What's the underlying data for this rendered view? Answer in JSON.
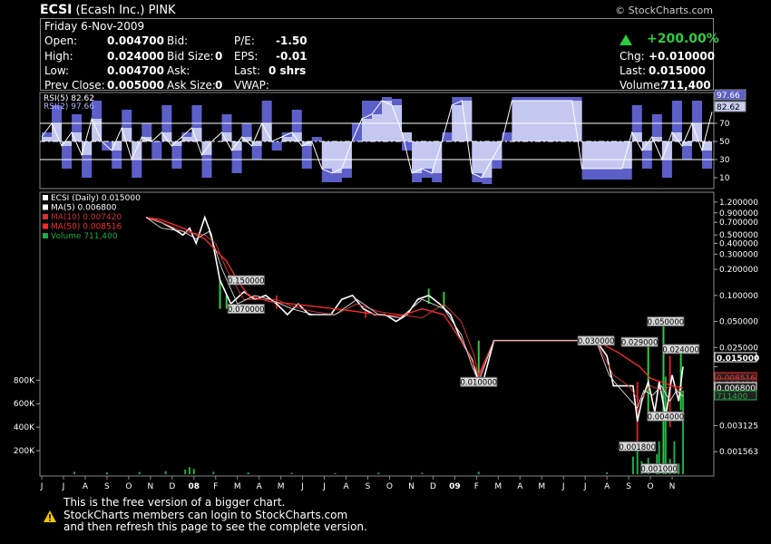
{
  "header": {
    "symbol": "ECSI",
    "company": "(Ecash Inc.)",
    "exchange": "PINK",
    "brand": "© StockCharts.com",
    "date": "Friday  6-Nov-2009"
  },
  "quote": {
    "open_label": "Open:",
    "open": "0.004700",
    "high_label": "High:",
    "high": "0.024000",
    "low_label": "Low:",
    "low": "0.004700",
    "prevclose_label": "Prev Close:",
    "prevclose": "0.005000",
    "bid_label": "Bid:",
    "bid": "",
    "bidsize_label": "Bid Size:",
    "bidsize": "0",
    "ask_label": "Ask:",
    "ask": "",
    "asksize_label": "Ask Size:",
    "asksize": "0",
    "pe_label": "P/E:",
    "pe": "-1.50",
    "eps_label": "EPS:",
    "eps": "-0.01",
    "last_label": "Last:",
    "last": "0 shrs",
    "vwap_label": "VWAP:",
    "vwap": "",
    "pct_change": "+200.00%",
    "chg_label": "Chg:",
    "chg": "+0.010000",
    "last2_label": "Last:",
    "last2": "0.015000",
    "volume_label": "Volume:",
    "volume": "711,400"
  },
  "colors": {
    "background": "#000000",
    "rsi_fill": "#c9cdf2",
    "rsi2_fill": "#5c5fc8",
    "price_line": "#ffffff",
    "ma5": "#ffffff",
    "ma10": "#cc3333",
    "ma50": "#ff2a2a",
    "volume": "#22aa44",
    "up_accent": "#2ecc40"
  },
  "footer": {
    "line1": "This is the free version of a bigger chart.",
    "line2": "StockCharts members can login to StockCharts.com",
    "line3": "and then refresh this page to see the complete version.",
    "warning_icon": "warning-triangle-icon"
  },
  "chart_data": [
    {
      "type": "line",
      "panel": "rsi",
      "legend": [
        "RSI(5) 82.62",
        "RSI(2) 97.66"
      ],
      "ylim": [
        0,
        100
      ],
      "y_ticks": [
        10,
        30,
        50,
        70,
        90
      ],
      "reference_lines": [
        30,
        50,
        70
      ],
      "last_values": [
        "97.66",
        "82.62"
      ],
      "series": [
        {
          "name": "RSI(5)",
          "values": [
            55,
            70,
            45,
            60,
            35,
            75,
            50,
            40,
            65,
            30,
            55,
            50,
            60,
            45,
            55,
            65,
            35,
            50,
            60,
            40,
            55,
            45,
            70,
            50,
            55,
            60,
            45,
            50,
            20,
            15,
            20,
            50,
            75,
            80,
            95,
            90,
            60,
            15,
            20,
            15,
            50,
            90,
            95,
            15,
            10,
            30,
            50,
            95,
            95,
            95,
            95,
            95,
            95,
            95,
            20,
            20,
            20,
            20,
            20,
            60,
            40,
            55,
            30,
            60,
            45,
            70,
            40,
            82.62
          ]
        },
        {
          "name": "RSI(2)",
          "values": [
            60,
            90,
            20,
            80,
            10,
            95,
            40,
            20,
            85,
            10,
            70,
            30,
            90,
            20,
            60,
            90,
            10,
            50,
            80,
            15,
            70,
            30,
            95,
            40,
            60,
            85,
            20,
            55,
            5,
            5,
            10,
            70,
            95,
            95,
            99,
            97,
            40,
            5,
            10,
            5,
            60,
            99,
            99,
            5,
            3,
            20,
            60,
            99,
            99,
            99,
            99,
            99,
            99,
            99,
            8,
            8,
            8,
            8,
            8,
            90,
            20,
            80,
            10,
            95,
            30,
            95,
            20,
            97.66
          ]
        }
      ]
    },
    {
      "type": "line",
      "panel": "price",
      "scale": "log",
      "legend": [
        "ECSI (Daily) 0.015000",
        "MA(5) 0.006800",
        "MA(10) 0.007420",
        "MA(50) 0.008516",
        "Volume 711,400"
      ],
      "x_labels": [
        "J",
        "J",
        "A",
        "S",
        "O",
        "N",
        "D",
        "08",
        "F",
        "M",
        "A",
        "M",
        "J",
        "J",
        "A",
        "S",
        "O",
        "N",
        "D",
        "09",
        "F",
        "M",
        "A",
        "M",
        "J",
        "J",
        "A",
        "S",
        "O",
        "N"
      ],
      "y_ticks": [
        "1.200000",
        "0.900000",
        "0.700000",
        "0.500000",
        "0.400000",
        "0.300000",
        "0.200000",
        "0.100000",
        "0.050000",
        "0.025000",
        "0.015000",
        "0.006800",
        "0.003125",
        "0.001563"
      ],
      "y_tick_values": [
        1.2,
        0.9,
        0.7,
        0.5,
        0.4,
        0.3,
        0.2,
        0.1,
        0.05,
        0.025,
        0.015,
        0.0068,
        0.003125,
        0.001563
      ],
      "last_value_tags": [
        {
          "label": "0.015000",
          "value": 0.015,
          "color": "#ffffff"
        },
        {
          "label": "0.008516",
          "value": 0.008516,
          "color": "#ff2a2a"
        },
        {
          "label": "0.007420",
          "value": 0.00742,
          "color": "#cc3333"
        },
        {
          "label": "0.006800",
          "value": 0.0068,
          "color": "#ffffff"
        },
        {
          "label": "711400",
          "value": 0.0058,
          "color": "#22aa44"
        }
      ],
      "annotations": [
        {
          "label": "0.150000",
          "t": 8.9,
          "value": 0.15
        },
        {
          "label": "0.070000",
          "t": 8.9,
          "value": 0.07
        },
        {
          "label": "0.010000",
          "t": 19.6,
          "value": 0.01
        },
        {
          "label": "0.030000",
          "t": 25.0,
          "value": 0.03
        },
        {
          "label": "0.029000",
          "t": 27.0,
          "value": 0.029
        },
        {
          "label": "0.050000",
          "t": 28.2,
          "value": 0.05
        },
        {
          "label": "0.024000",
          "t": 28.9,
          "value": 0.024
        },
        {
          "label": "0.004000",
          "t": 28.2,
          "value": 0.004
        },
        {
          "label": "0.001800",
          "t": 26.9,
          "value": 0.0018
        },
        {
          "label": "0.001000",
          "t": 27.9,
          "value": 0.001
        }
      ],
      "series": [
        {
          "name": "ECSI (Daily)",
          "t": [
            4.3,
            5.0,
            5.5,
            6.0,
            6.3,
            6.6,
            7.0,
            7.3,
            7.7,
            8.2,
            8.8,
            9.3,
            9.8,
            10.3,
            10.8,
            11.3,
            11.8,
            12.3,
            12.8,
            13.3,
            13.8,
            14.3,
            14.8,
            15.3,
            15.8,
            16.3,
            16.8,
            17.3,
            17.8,
            18.3,
            18.8,
            19.3,
            19.6,
            19.8,
            20.3,
            21.0,
            22.0,
            23.0,
            24.0,
            25.0,
            25.5,
            25.8,
            26.3,
            26.7,
            26.9,
            27.1,
            27.4,
            27.7,
            27.9,
            28.2,
            28.5,
            28.8,
            29.0
          ],
          "values": [
            0.8,
            0.7,
            0.6,
            0.5,
            0.6,
            0.4,
            0.8,
            0.5,
            0.15,
            0.08,
            0.11,
            0.09,
            0.1,
            0.08,
            0.06,
            0.08,
            0.06,
            0.06,
            0.06,
            0.09,
            0.1,
            0.07,
            0.06,
            0.06,
            0.05,
            0.06,
            0.09,
            0.1,
            0.08,
            0.06,
            0.03,
            0.018,
            0.01,
            0.01,
            0.03,
            0.03,
            0.03,
            0.03,
            0.03,
            0.03,
            0.02,
            0.009,
            0.009,
            0.009,
            0.0035,
            0.006,
            0.01,
            0.0045,
            0.01,
            0.004,
            0.012,
            0.006,
            0.015
          ]
        },
        {
          "name": "MA(50)",
          "t": [
            4.3,
            5.0,
            6.0,
            7.0,
            8.0,
            8.5,
            9.0,
            10.0,
            11.0,
            12.0,
            13.0,
            14.0,
            15.0,
            16.0,
            17.0,
            18.0,
            19.0,
            19.6,
            20.3,
            22.0,
            24.0,
            25.0,
            26.0,
            27.0,
            27.5,
            28.0,
            28.5,
            29.0
          ],
          "values": [
            0.8,
            0.75,
            0.6,
            0.45,
            0.25,
            0.15,
            0.1,
            0.085,
            0.08,
            0.075,
            0.07,
            0.065,
            0.06,
            0.058,
            0.07,
            0.06,
            0.025,
            0.012,
            0.03,
            0.03,
            0.03,
            0.03,
            0.022,
            0.015,
            0.011,
            0.01,
            0.009,
            0.008516
          ]
        },
        {
          "name": "MA(10)",
          "t": [
            4.3,
            5.0,
            6.0,
            7.0,
            7.5,
            8.0,
            8.8,
            9.5,
            10.3,
            11.0,
            12.0,
            13.0,
            14.0,
            15.0,
            16.0,
            17.0,
            18.0,
            18.8,
            19.4,
            19.6,
            20.3,
            25.0,
            25.8,
            26.5,
            27.0,
            27.5,
            28.0,
            28.5,
            29.0
          ],
          "values": [
            0.8,
            0.7,
            0.55,
            0.5,
            0.4,
            0.2,
            0.09,
            0.09,
            0.09,
            0.075,
            0.065,
            0.06,
            0.08,
            0.065,
            0.06,
            0.055,
            0.08,
            0.05,
            0.02,
            0.011,
            0.03,
            0.03,
            0.012,
            0.009,
            0.006,
            0.009,
            0.008,
            0.009,
            0.00742
          ]
        },
        {
          "name": "MA(5)",
          "t": [
            4.3,
            5.0,
            6.0,
            6.6,
            7.2,
            7.8,
            8.5,
            9.3,
            10.0,
            11.0,
            12.0,
            13.0,
            14.0,
            15.0,
            16.0,
            17.0,
            18.0,
            18.8,
            19.3,
            19.6,
            20.3,
            25.0,
            25.6,
            26.0,
            26.9,
            27.2,
            27.6,
            28.0,
            28.4,
            28.7,
            29.0
          ],
          "values": [
            0.8,
            0.6,
            0.55,
            0.45,
            0.55,
            0.2,
            0.08,
            0.1,
            0.09,
            0.07,
            0.06,
            0.06,
            0.09,
            0.06,
            0.055,
            0.09,
            0.07,
            0.035,
            0.015,
            0.01,
            0.03,
            0.03,
            0.012,
            0.009,
            0.005,
            0.008,
            0.007,
            0.009,
            0.006,
            0.008,
            0.0068
          ]
        }
      ]
    },
    {
      "type": "bar",
      "panel": "volume",
      "ylim": [
        0,
        1000000
      ],
      "y_ticks": [
        "800K",
        "600K",
        "400K",
        "200K"
      ],
      "y_tick_values": [
        800000,
        600000,
        400000,
        200000
      ],
      "bars": [
        {
          "t": 1.0,
          "value": 20000
        },
        {
          "t": 2.5,
          "value": 15000
        },
        {
          "t": 4.0,
          "value": 18000
        },
        {
          "t": 5.2,
          "value": 25000
        },
        {
          "t": 6.1,
          "value": 40000
        },
        {
          "t": 6.3,
          "value": 60000
        },
        {
          "t": 6.5,
          "value": 45000
        },
        {
          "t": 7.4,
          "value": 20000
        },
        {
          "t": 9.0,
          "value": 15000
        },
        {
          "t": 11.0,
          "value": 12000
        },
        {
          "t": 13.0,
          "value": 10000
        },
        {
          "t": 15.0,
          "value": 14000
        },
        {
          "t": 17.0,
          "value": 12000
        },
        {
          "t": 19.6,
          "value": 20000
        },
        {
          "t": 25.5,
          "value": 15000
        },
        {
          "t": 26.7,
          "value": 150000
        },
        {
          "t": 26.9,
          "value": 240000
        },
        {
          "t": 27.1,
          "value": 110000
        },
        {
          "t": 27.4,
          "value": 140000
        },
        {
          "t": 27.8,
          "value": 170000
        },
        {
          "t": 27.9,
          "value": 280000
        },
        {
          "t": 28.1,
          "value": 950000
        },
        {
          "t": 28.2,
          "value": 830000
        },
        {
          "t": 28.4,
          "value": 130000
        },
        {
          "t": 28.6,
          "value": 280000
        },
        {
          "t": 28.8,
          "value": 90000
        },
        {
          "t": 29.0,
          "value": 711400
        }
      ]
    }
  ]
}
